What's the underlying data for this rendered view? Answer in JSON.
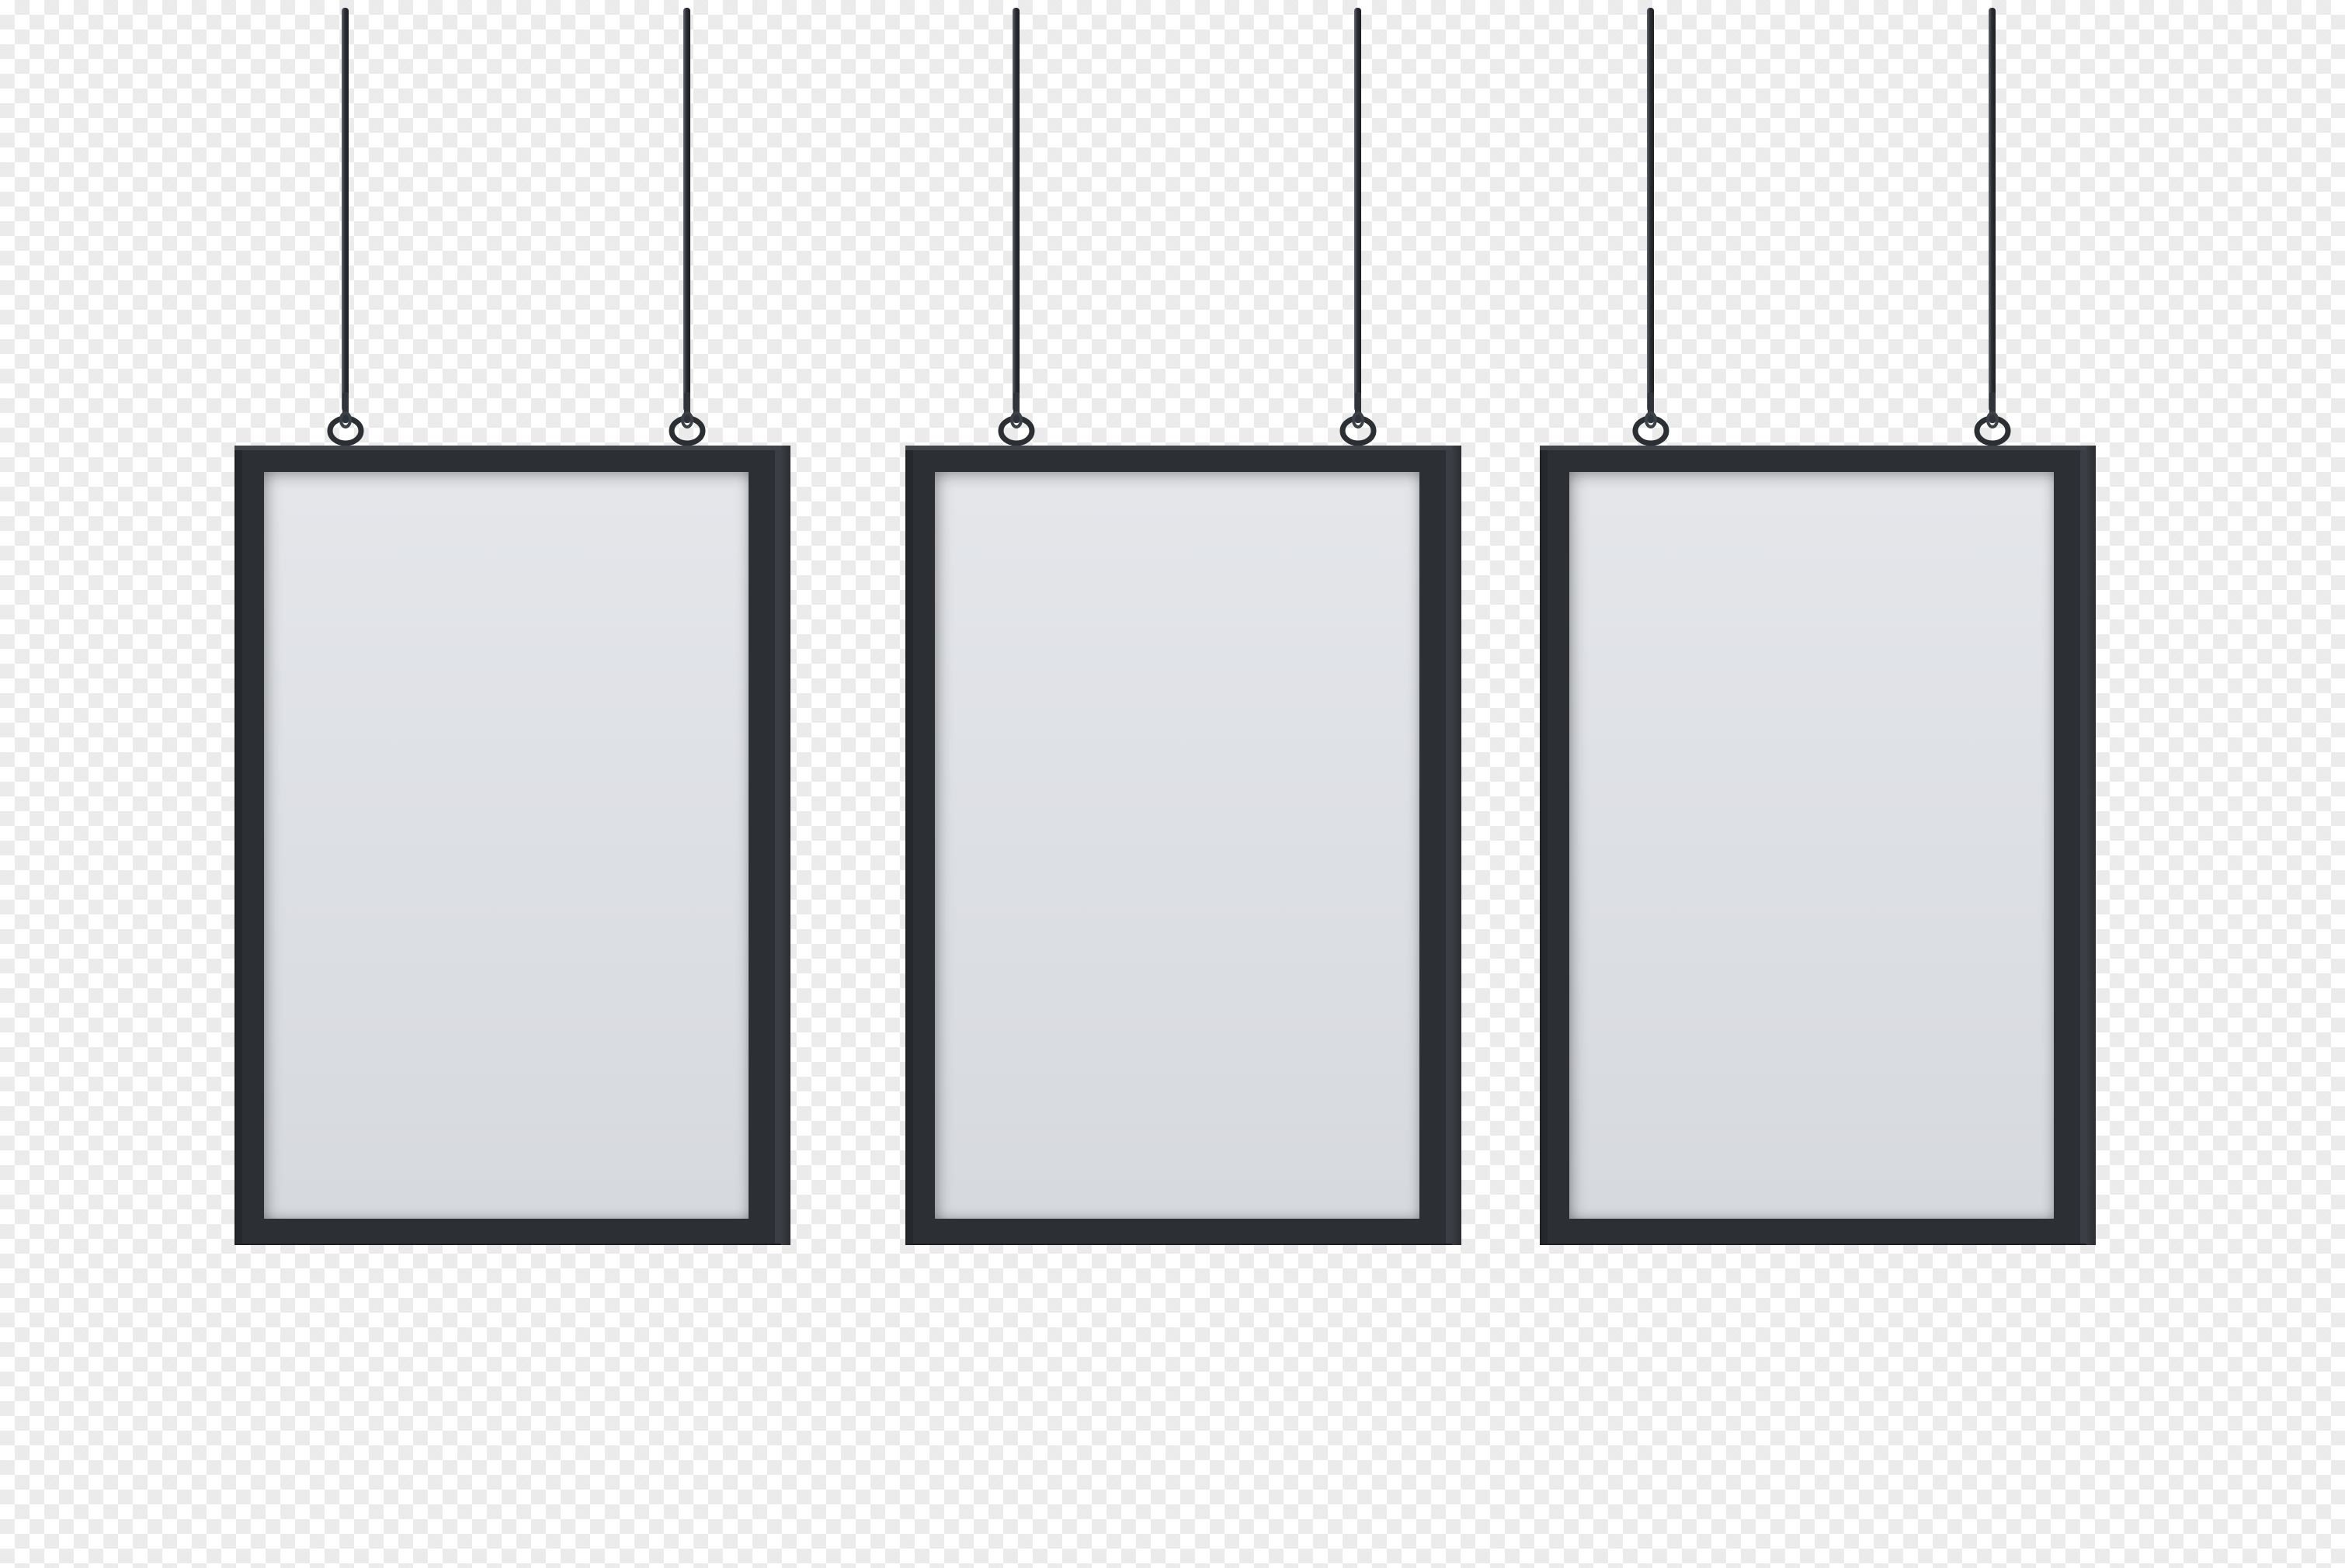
{
  "scene": {
    "background": "transparency-checkerboard",
    "colors": {
      "checker_light": "#ffffff",
      "checker_dark": "#ebebeb",
      "frame": "#2c2f33",
      "poster": "#dcdfe4",
      "cable": "#2a2d32"
    }
  },
  "frames": [
    {
      "id": "frame-1",
      "poster_text": ""
    },
    {
      "id": "frame-2",
      "poster_text": ""
    },
    {
      "id": "frame-3",
      "poster_text": ""
    }
  ]
}
